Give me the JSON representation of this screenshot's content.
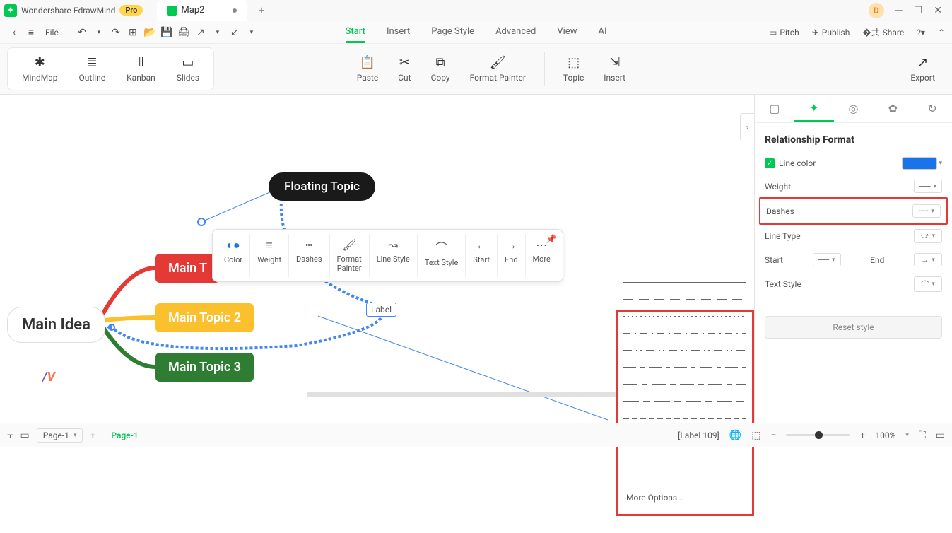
{
  "app": {
    "title": "Wondershare EdrawMind",
    "pro": "Pro",
    "doc": "Map2",
    "user": "D"
  },
  "menu": {
    "file": "File"
  },
  "tabs": {
    "start": "Start",
    "insert": "Insert",
    "pageStyle": "Page Style",
    "advanced": "Advanced",
    "view": "View",
    "ai": "AI"
  },
  "menuRight": {
    "pitch": "Pitch",
    "publish": "Publish",
    "share": "Share"
  },
  "ribbon": {
    "views": {
      "mindmap": "MindMap",
      "outline": "Outline",
      "kanban": "Kanban",
      "slides": "Slides"
    },
    "clip": {
      "paste": "Paste",
      "cut": "Cut",
      "copy": "Copy",
      "fp": "Format Painter"
    },
    "ins": {
      "topic": "Topic",
      "insert": "Insert"
    },
    "export": "Export"
  },
  "canvas": {
    "mainIdea": "Main Idea",
    "t1": "Main T",
    "t2": "Main Topic 2",
    "t3": "Main Topic 3",
    "float": "Floating Topic",
    "label": "Label"
  },
  "floatTb": {
    "color": "Color",
    "weight": "Weight",
    "dashes": "Dashes",
    "fp1": "Format",
    "fp2": "Painter",
    "lineStyle": "Line Style",
    "textStyle": "Text Style",
    "start": "Start",
    "end": "End",
    "more": "More"
  },
  "dashPopup": {
    "more": "More Options..."
  },
  "side": {
    "title": "Relationship Format",
    "lineColor": "Line color",
    "weight": "Weight",
    "dashes": "Dashes",
    "lineType": "Line Type",
    "start": "Start",
    "end": "End",
    "textStyle": "Text Style",
    "reset": "Reset style"
  },
  "status": {
    "pageSel": "Page-1",
    "pageTab": "Page-1",
    "label": "[Label 109]",
    "zoom": "100%"
  }
}
